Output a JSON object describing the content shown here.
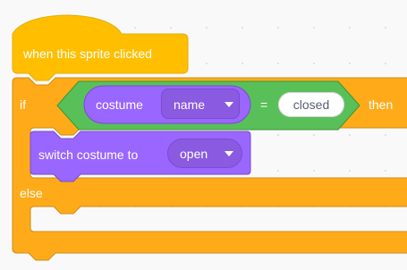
{
  "event_block": {
    "label": "when this sprite clicked"
  },
  "if_else_block": {
    "if_label": "if",
    "then_label": "then",
    "else_label": "else"
  },
  "condition": {
    "costume_label": "costume",
    "attribute_value": "name",
    "operator": "=",
    "compare_value": "closed"
  },
  "switch_block": {
    "label": "switch costume to",
    "costume_value": "open"
  },
  "colors": {
    "events": "#ffbf00",
    "control": "#ffab19",
    "operators": "#59c059",
    "looks": "#9966ff",
    "workspace": "#f9f9f9"
  }
}
